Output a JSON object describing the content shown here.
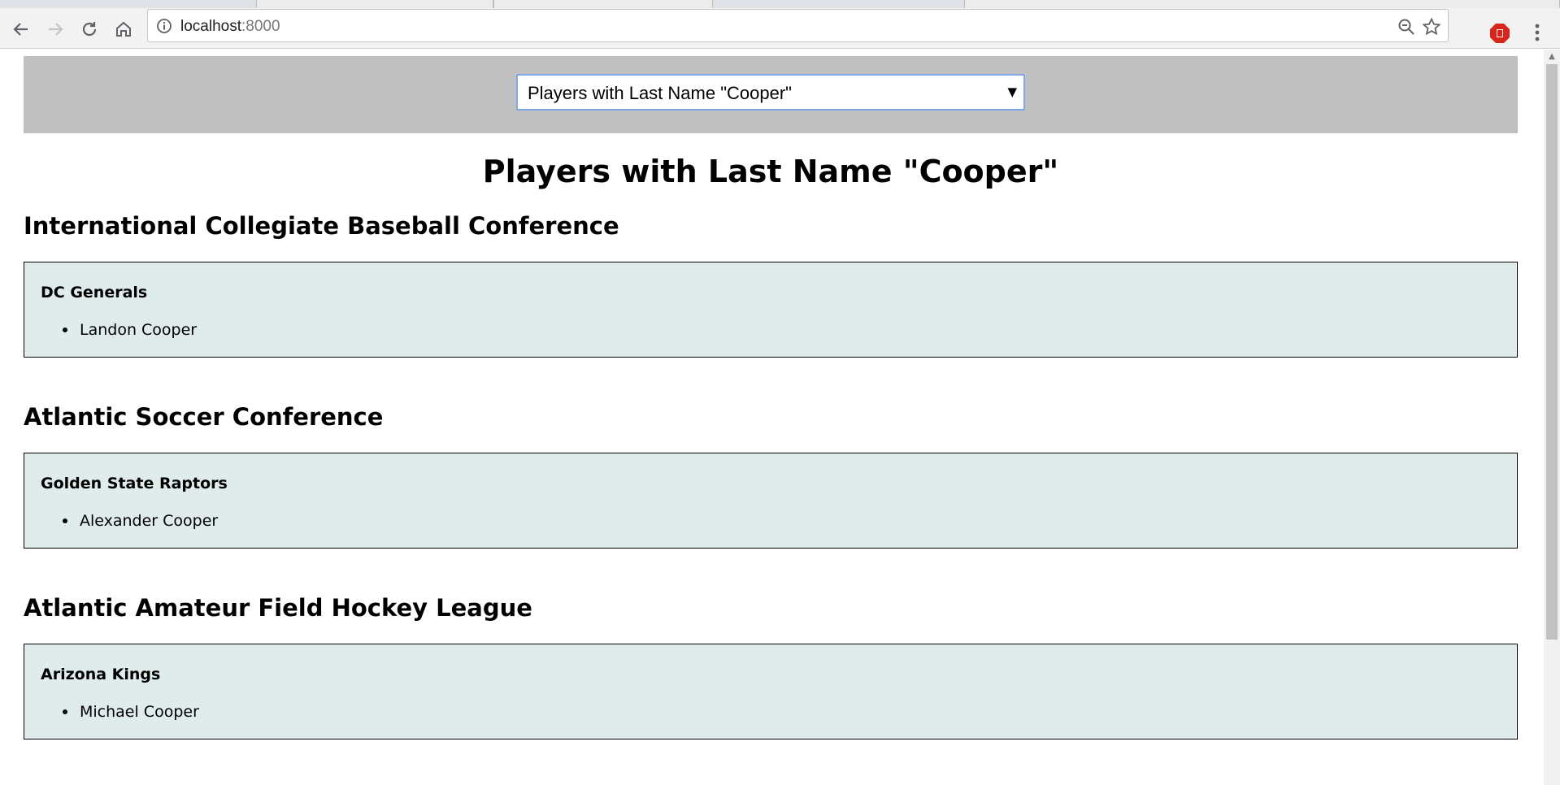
{
  "browser": {
    "url_host": "localhost",
    "url_port": ":8000"
  },
  "filter": {
    "selected": "Players with Last Name \"Cooper\""
  },
  "page": {
    "title": "Players with Last Name \"Cooper\""
  },
  "leagues": [
    {
      "name": "International Collegiate Baseball Conference",
      "team": "DC Generals",
      "players": [
        "Landon Cooper"
      ]
    },
    {
      "name": "Atlantic Soccer Conference",
      "team": "Golden State Raptors",
      "players": [
        "Alexander Cooper"
      ]
    },
    {
      "name": "Atlantic Amateur Field Hockey League",
      "team": "Arizona Kings",
      "players": [
        "Michael Cooper"
      ]
    }
  ],
  "colors": {
    "select_bar": "#c0c0c0",
    "team_box": "#e0ebeb"
  },
  "icons": [
    "back-icon",
    "forward-icon",
    "reload-icon",
    "home-icon",
    "info-icon",
    "zoom-icon",
    "star-icon",
    "extension-icon",
    "menu-icon"
  ]
}
